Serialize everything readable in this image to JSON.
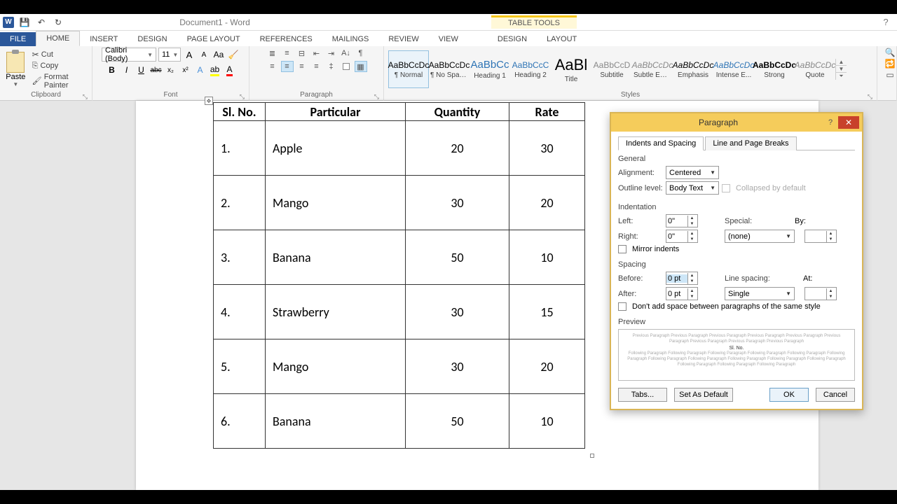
{
  "titlebar": {
    "app_icon": "W",
    "qat": {
      "save": "💾",
      "undo": "↶",
      "redo": "↻"
    },
    "title": "Document1 - Word",
    "table_tools": "TABLE TOOLS",
    "help": "?"
  },
  "tabs": {
    "file": "FILE",
    "items": [
      "HOME",
      "INSERT",
      "DESIGN",
      "PAGE LAYOUT",
      "REFERENCES",
      "MAILINGS",
      "REVIEW",
      "VIEW"
    ],
    "context": [
      "DESIGN",
      "LAYOUT"
    ]
  },
  "ribbon": {
    "clipboard": {
      "label": "Clipboard",
      "paste": "Paste",
      "cut": "Cut",
      "copy": "Copy",
      "format_painter": "Format Painter"
    },
    "font": {
      "label": "Font",
      "name": "Calibri (Body)",
      "size": "11",
      "grow": "A",
      "shrink": "A",
      "case": "Aa",
      "clear": "🧽",
      "bold": "B",
      "italic": "I",
      "underline": "U",
      "strike": "abc",
      "sub": "x₂",
      "sup": "x²",
      "effects": "A",
      "highlight": "ab",
      "color": "A"
    },
    "paragraph": {
      "label": "Paragraph"
    },
    "styles": {
      "label": "Styles",
      "items": [
        {
          "prev": "AaBbCcDc",
          "name": "¶ Normal",
          "sel": true
        },
        {
          "prev": "AaBbCcDc",
          "name": "¶ No Spac..."
        },
        {
          "prev": "AaBbCc",
          "name": "Heading 1",
          "color": "#2e74b5",
          "size": "15px"
        },
        {
          "prev": "AaBbCcC",
          "name": "Heading 2",
          "color": "#2e74b5"
        },
        {
          "prev": "AaBl",
          "name": "Title",
          "size": "22px"
        },
        {
          "prev": "AaBbCcD",
          "name": "Subtitle",
          "color": "#888"
        },
        {
          "prev": "AaBbCcDc",
          "name": "Subtle Em...",
          "it": true,
          "color": "#888"
        },
        {
          "prev": "AaBbCcDc",
          "name": "Emphasis",
          "it": true
        },
        {
          "prev": "AaBbCcDc",
          "name": "Intense E...",
          "it": true,
          "color": "#2e74b5"
        },
        {
          "prev": "AaBbCcDc",
          "name": "Strong",
          "bold": true
        },
        {
          "prev": "AaBbCcDc",
          "name": "Quote",
          "it": true,
          "color": "#888"
        }
      ]
    }
  },
  "table": {
    "headers": [
      "Sl. No.",
      "Particular",
      "Quantity",
      "Rate"
    ],
    "rows": [
      {
        "sl": "1.",
        "part": "Apple",
        "qty": "20",
        "rate": "30"
      },
      {
        "sl": "2.",
        "part": "Mango",
        "qty": "30",
        "rate": "20"
      },
      {
        "sl": "3.",
        "part": "Banana",
        "qty": "50",
        "rate": "10"
      },
      {
        "sl": "4.",
        "part": "Strawberry",
        "qty": "30",
        "rate": "15"
      },
      {
        "sl": "5.",
        "part": "Mango",
        "qty": "30",
        "rate": "20"
      },
      {
        "sl": "6.",
        "part": "Banana",
        "qty": "50",
        "rate": "10"
      }
    ]
  },
  "dialog": {
    "title": "Paragraph",
    "tab1": "Indents and Spacing",
    "tab2": "Line and Page Breaks",
    "general": "General",
    "alignment_l": "Alignment:",
    "alignment_v": "Centered",
    "outline_l": "Outline level:",
    "outline_v": "Body Text",
    "collapsed": "Collapsed by default",
    "indentation": "Indentation",
    "left_l": "Left:",
    "left_v": "0\"",
    "right_l": "Right:",
    "right_v": "0\"",
    "special_l": "Special:",
    "special_v": "(none)",
    "by_l": "By:",
    "by_v": "",
    "mirror": "Mirror indents",
    "spacing": "Spacing",
    "before_l": "Before:",
    "before_v": "0 pt",
    "after_l": "After:",
    "after_v": "0 pt",
    "ls_l": "Line spacing:",
    "ls_v": "Single",
    "at_l": "At:",
    "at_v": "",
    "noaddspace": "Don't add space between paragraphs of the same style",
    "preview": "Preview",
    "preview_center": "Sl. No.",
    "tabs_btn": "Tabs...",
    "default_btn": "Set As Default",
    "ok": "OK",
    "cancel": "Cancel"
  }
}
